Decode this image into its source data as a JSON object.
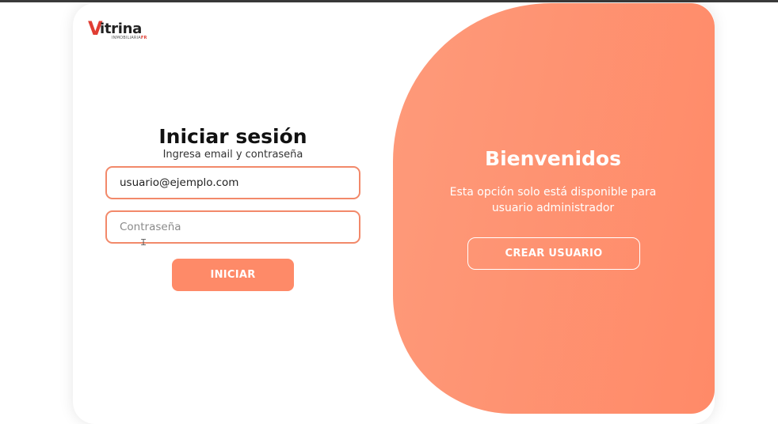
{
  "logo": {
    "initial": "V",
    "rest": "itrina",
    "subtitle_prefix": "INMOBILIARIA",
    "subtitle_suffix": "FR"
  },
  "login": {
    "title": "Iniciar sesión",
    "subtitle": "Ingresa email y contraseña",
    "email_value": "usuario@ejemplo.com",
    "password_placeholder": "Contraseña",
    "submit_label": "INICIAR"
  },
  "welcome": {
    "title": "Bienvenidos",
    "text": "Esta opción solo está disponible para usuario administrador",
    "create_button_label": "CREAR USUARIO"
  },
  "colors": {
    "accent": "#fe8a68",
    "field_border": "#f2896a",
    "logo_red": "#e03d33"
  }
}
